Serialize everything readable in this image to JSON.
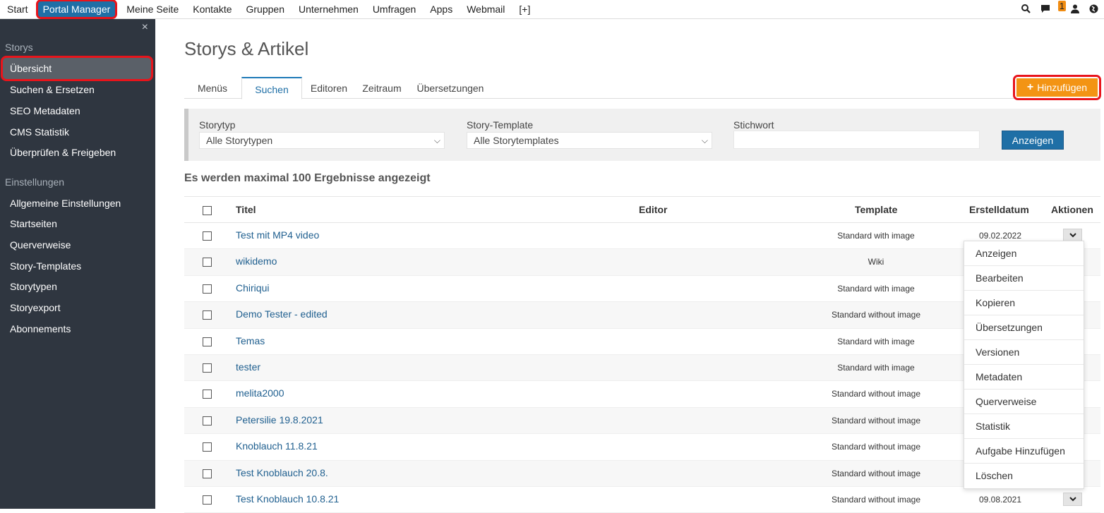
{
  "topnav": {
    "items": [
      {
        "label": "Start"
      },
      {
        "label": "Portal Manager",
        "active": true
      },
      {
        "label": "Meine Seite"
      },
      {
        "label": "Kontakte"
      },
      {
        "label": "Gruppen"
      },
      {
        "label": "Unternehmen"
      },
      {
        "label": "Umfragen"
      },
      {
        "label": "Apps"
      },
      {
        "label": "Webmail"
      },
      {
        "label": "[+]"
      }
    ],
    "icons": [
      "search-icon",
      "messages-icon",
      "user-icon",
      "globe-icon"
    ],
    "message_count": "1"
  },
  "sidebar": {
    "close_label": "×",
    "section_storys": "Storys",
    "storys_items": [
      {
        "label": "Übersicht",
        "active": true
      },
      {
        "label": "Suchen & Ersetzen"
      },
      {
        "label": "SEO Metadaten"
      },
      {
        "label": "CMS Statistik"
      },
      {
        "label": "Überprüfen & Freigeben"
      }
    ],
    "section_settings": "Einstellungen",
    "settings_items": [
      {
        "label": "Allgemeine Einstellungen"
      },
      {
        "label": "Startseiten"
      },
      {
        "label": "Querverweise"
      },
      {
        "label": "Story-Templates"
      },
      {
        "label": "Storytypen"
      },
      {
        "label": "Storyexport"
      },
      {
        "label": "Abonnements"
      }
    ]
  },
  "main": {
    "title": "Storys & Artikel",
    "tabs": [
      {
        "label": "Menüs"
      },
      {
        "label": "Suchen",
        "active": true
      },
      {
        "label": "Editoren"
      },
      {
        "label": "Zeitraum"
      },
      {
        "label": "Übersetzungen"
      }
    ],
    "add_button": "Hinzufügen",
    "filters": {
      "storytyp_label": "Storytyp",
      "storytyp_value": "Alle Storytypen",
      "template_label": "Story-Template",
      "template_value": "Alle Storytemplates",
      "keyword_label": "Stichwort",
      "keyword_value": "",
      "show_button": "Anzeigen"
    },
    "result_note": "Es werden maximal 100 Ergebnisse angezeigt",
    "table": {
      "headers": {
        "title": "Titel",
        "editor": "Editor",
        "template": "Template",
        "date": "Erstelldatum",
        "actions": "Aktionen"
      },
      "rows": [
        {
          "title": "Test mit MP4 video",
          "template": "Standard with image",
          "date": "09.02.2022"
        },
        {
          "title": "wikidemo",
          "template": "Wiki",
          "date": ""
        },
        {
          "title": "Chiriqui",
          "template": "Standard with image",
          "date": ""
        },
        {
          "title": "Demo Tester - edited",
          "template": "Standard without image",
          "date": ""
        },
        {
          "title": "Temas",
          "template": "Standard with image",
          "date": ""
        },
        {
          "title": "tester",
          "template": "Standard with image",
          "date": ""
        },
        {
          "title": "melita2000",
          "template": "Standard without image",
          "date": ""
        },
        {
          "title": "Petersilie 19.8.2021",
          "template": "Standard without image",
          "date": ""
        },
        {
          "title": "Knoblauch 11.8.21",
          "template": "Standard without image",
          "date": ""
        },
        {
          "title": "Test Knoblauch 20.8.",
          "template": "Standard without image",
          "date": ""
        },
        {
          "title": "Test Knoblauch 10.8.21",
          "template": "Standard without image",
          "date": "09.08.2021"
        }
      ]
    },
    "actions_menu": [
      "Anzeigen",
      "Bearbeiten",
      "Kopieren",
      "Übersetzungen",
      "Versionen",
      "Metadaten",
      "Querverweise",
      "Statistik",
      "Aufgabe Hinzufügen",
      "Löschen"
    ]
  },
  "colors": {
    "accent_blue": "#1f6fa6",
    "add_orange": "#f39414",
    "sidebar_bg": "#2f3640",
    "highlight_red": "#e8141b"
  }
}
